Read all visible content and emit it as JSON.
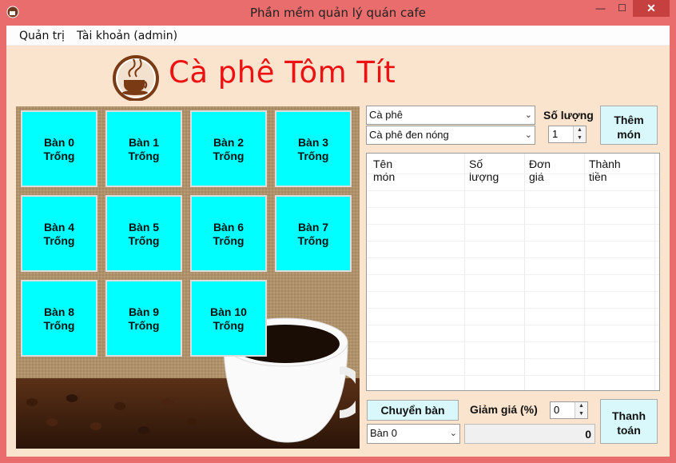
{
  "window": {
    "title": "Phần mềm quản lý quán cafe",
    "min_glyph": "—",
    "max_glyph": "☐",
    "close_glyph": "✕"
  },
  "menu": {
    "admin": "Quản trị",
    "account": "Tài khoản (admin)"
  },
  "brand": {
    "name": "Cà phê Tôm Tít",
    "color": "#ee1111"
  },
  "tables": [
    {
      "name": "Bàn 0",
      "status": "Trống"
    },
    {
      "name": "Bàn 1",
      "status": "Trống"
    },
    {
      "name": "Bàn 2",
      "status": "Trống"
    },
    {
      "name": "Bàn 3",
      "status": "Trống"
    },
    {
      "name": "Bàn 4",
      "status": "Trống"
    },
    {
      "name": "Bàn 5",
      "status": "Trống"
    },
    {
      "name": "Bàn 6",
      "status": "Trống"
    },
    {
      "name": "Bàn 7",
      "status": "Trống"
    },
    {
      "name": "Bàn 8",
      "status": "Trống"
    },
    {
      "name": "Bàn 9",
      "status": "Trống"
    },
    {
      "name": "Bàn 10",
      "status": "Trống"
    }
  ],
  "table_color": "#00ffff",
  "order": {
    "category_selected": "Cà phê",
    "food_selected": "Cà phê đen nóng",
    "quantity_label": "Số lượng",
    "quantity_value": "1",
    "add_button_line1": "Thêm",
    "add_button_line2": "món"
  },
  "bill": {
    "columns": [
      "Tên món",
      "Số lượng",
      "Đơn giá",
      "Thành tiền"
    ]
  },
  "footer": {
    "switch_button": "Chuyển bàn",
    "switch_table_selected": "Bàn 0",
    "discount_label": "Giảm giá (%)",
    "discount_value": "0",
    "total_value": "0",
    "pay_button_line1": "Thanh",
    "pay_button_line2": "toán"
  },
  "icons": {
    "app": "coffee-app-icon",
    "logo": "coffee-cup-logo-icon",
    "dropdown": "chevron-down-icon",
    "spinner": "spinner-arrows-icon"
  }
}
